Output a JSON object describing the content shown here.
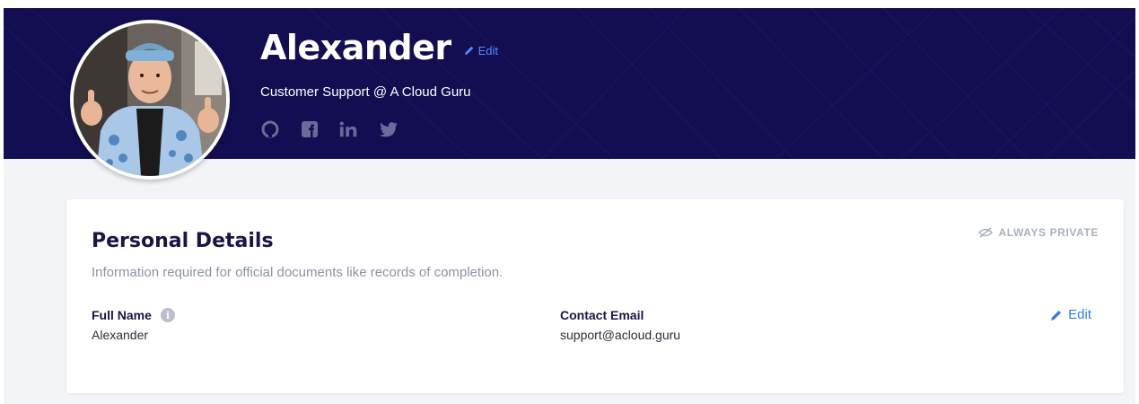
{
  "profile": {
    "name": "Alexander",
    "name_edit_label": "Edit",
    "tagline": "Customer Support @ A Cloud Guru",
    "socials": [
      {
        "icon": "github-icon"
      },
      {
        "icon": "facebook-icon"
      },
      {
        "icon": "linkedin-icon"
      },
      {
        "icon": "twitter-icon"
      }
    ]
  },
  "personal_details": {
    "title": "Personal Details",
    "subtitle": "Information required for official documents like records of completion.",
    "privacy_label": "ALWAYS PRIVATE",
    "edit_label": "Edit",
    "fields": {
      "full_name": {
        "label": "Full Name",
        "value": "Alexander"
      },
      "contact_email": {
        "label": "Contact Email",
        "value": "support@acloud.guru"
      }
    }
  },
  "colors": {
    "banner": "#130d52",
    "accent": "#2f7de1",
    "heading": "#1a1546",
    "muted": "#8b93a8"
  }
}
